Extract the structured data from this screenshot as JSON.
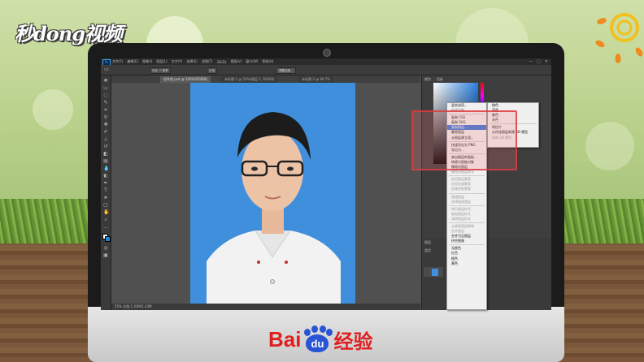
{
  "brand": {
    "watermark": "秒dong视频"
  },
  "footer": {
    "logo_bai": "Bai",
    "logo_du": "du",
    "logo_suffix": "经验"
  },
  "photoshop": {
    "menu": [
      "文件(F)",
      "编辑(E)",
      "图像(I)",
      "图层(L)",
      "文字(Y)",
      "选择(S)",
      "滤镜(T)",
      "3D(D)",
      "视图(V)",
      "窗口(W)",
      "帮助(H)"
    ],
    "window_controls": [
      "—",
      "▢",
      "✕"
    ],
    "options": {
      "feather": "羽化: 0 像素",
      "style": "正常",
      "refine_button": "调整边缘..."
    },
    "tabs": [
      "证件照.psd @ 100%(RGB/8)",
      "未标题-1 @ 50%(图层 1, RGB/8)",
      "未标题-2 @ 66.7%"
    ],
    "status": "25% 文档:1.43M/1.43M",
    "panel_headers": {
      "color": "颜色",
      "swatches": "色板",
      "layers": "图层",
      "kind": "类型"
    },
    "context_menu_left": [
      {
        "label": "混合选项...",
        "state": "normal"
      },
      {
        "label": "编辑调整...",
        "state": "disabled"
      },
      {
        "sep": true
      },
      {
        "label": "复制 CSS",
        "state": "normal"
      },
      {
        "label": "复制 SVG",
        "state": "normal"
      },
      {
        "label": "复制图层...",
        "state": "selected"
      },
      {
        "label": "删除图层",
        "state": "normal"
      },
      {
        "label": "从图层建立组...",
        "state": "normal"
      },
      {
        "sep": true
      },
      {
        "label": "快速导出为 PNG",
        "state": "normal"
      },
      {
        "label": "导出为...",
        "state": "normal"
      },
      {
        "sep": true
      },
      {
        "label": "来自图层的画板...",
        "state": "normal"
      },
      {
        "label": "转换为智能对象",
        "state": "normal"
      },
      {
        "label": "栅格化图层",
        "state": "normal"
      },
      {
        "label": "栅格化图层样式",
        "state": "disabled"
      },
      {
        "sep": true
      },
      {
        "label": "启用图层蒙版",
        "state": "disabled"
      },
      {
        "label": "启用矢量蒙版",
        "state": "disabled"
      },
      {
        "label": "创建剪贴蒙版",
        "state": "disabled"
      },
      {
        "sep": true
      },
      {
        "label": "链接图层",
        "state": "disabled"
      },
      {
        "label": "选择链接图层",
        "state": "disabled"
      },
      {
        "sep": true
      },
      {
        "label": "拷贝图层样式",
        "state": "disabled"
      },
      {
        "label": "粘贴图层样式",
        "state": "disabled"
      },
      {
        "label": "清除图层样式",
        "state": "disabled"
      },
      {
        "sep": true
      },
      {
        "label": "从隔离图层释放",
        "state": "disabled"
      },
      {
        "label": "合并图层",
        "state": "disabled"
      },
      {
        "label": "合并可见图层",
        "state": "normal"
      },
      {
        "label": "拼合图像",
        "state": "normal"
      },
      {
        "sep": true
      },
      {
        "label": "无颜色",
        "state": "normal"
      },
      {
        "label": "红色",
        "state": "normal"
      },
      {
        "label": "橙色",
        "state": "normal"
      },
      {
        "label": "黄色",
        "state": "normal"
      }
    ],
    "context_menu_right": [
      {
        "label": "橙色",
        "state": "normal"
      },
      {
        "label": "蓝色",
        "state": "normal"
      },
      {
        "label": "紫色",
        "state": "normal"
      },
      {
        "label": "灰色",
        "state": "normal"
      },
      {
        "sep": true
      },
      {
        "label": "明信片",
        "state": "normal"
      },
      {
        "label": "从所选图层新建 3D 模型",
        "state": "normal"
      },
      {
        "label": "新建 3D 模型",
        "state": "disabled"
      }
    ]
  }
}
